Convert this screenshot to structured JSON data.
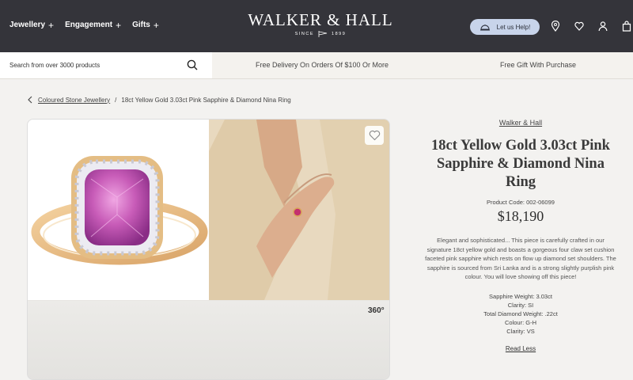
{
  "nav": {
    "items": [
      {
        "label": "Jewellery"
      },
      {
        "label": "Engagement"
      },
      {
        "label": "Gifts"
      }
    ],
    "brand": "WALKER & HALL",
    "since": "SINCE",
    "year": "1899",
    "help_label": "Let us Help!"
  },
  "subbar": {
    "search_placeholder": "Search from over 3000 products",
    "promo1": "Free Delivery On Orders Of $100 Or More",
    "promo2": "Free Gift With Purchase"
  },
  "breadcrumb": {
    "link": "Coloured Stone Jewellery",
    "separator": "/",
    "current": "18ct Yellow Gold 3.03ct Pink Sapphire & Diamond Nina Ring"
  },
  "gallery": {
    "label_360": "360°"
  },
  "product": {
    "brand": "Walker & Hall",
    "title": "18ct Yellow Gold 3.03ct Pink Sapphire & Diamond Nina Ring",
    "code": "Product Code: 002-06099",
    "price": "$18,190",
    "description": "Elegant and sophisticated... This piece is carefully crafted in our signature 18ct yellow gold and boasts a gorgeous four claw set cushion faceted pink sapphire which rests on flow up diamond set shoulders. The sapphire is sourced from Sri Lanka and is a strong slightly purplish pink colour. You will love showing off this piece!",
    "specs": [
      "Sapphire Weight: 3.03ct",
      "Clarity: SI",
      "Total Diamond Weight: .22ct",
      "Colour: G-H",
      "Clarity: VS"
    ],
    "read_less": "Read Less"
  },
  "colors": {
    "nav_bg": "#34343a",
    "help_bg": "#c8d4ea",
    "page_bg": "#f3f2f0"
  }
}
